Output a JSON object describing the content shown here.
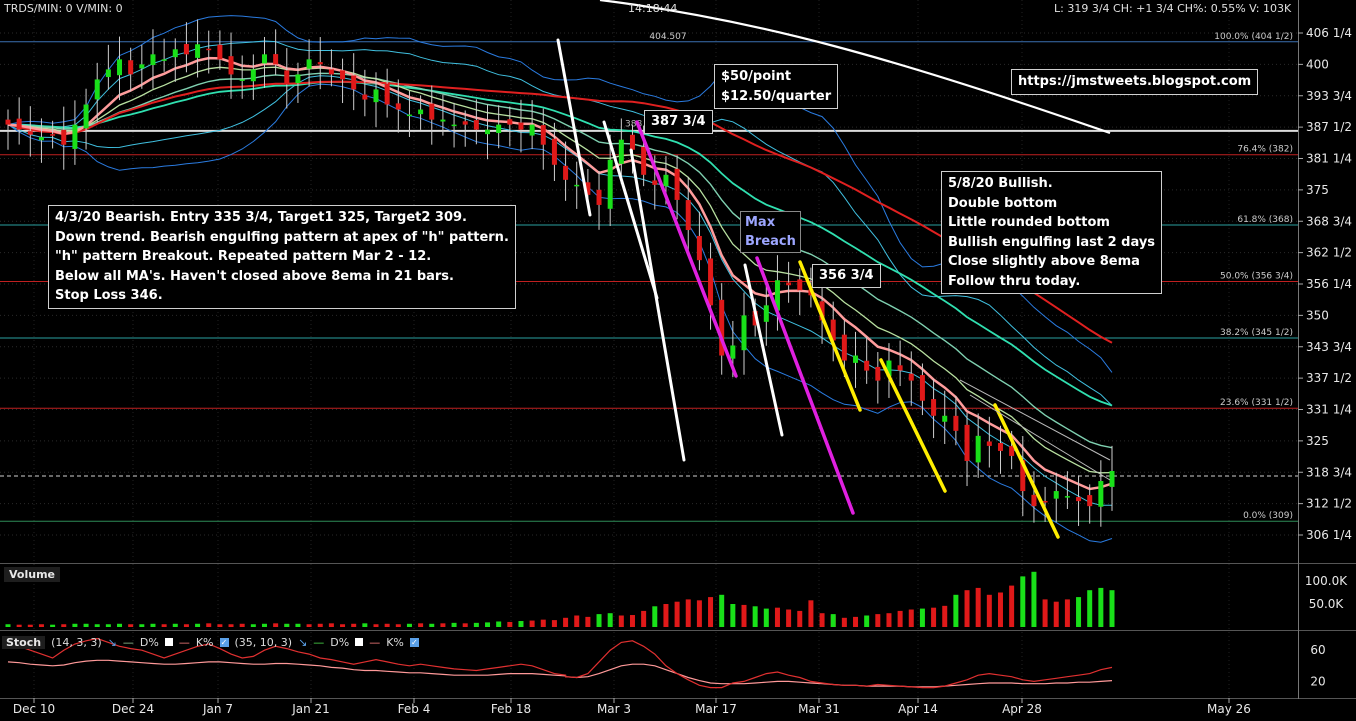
{
  "header": {
    "left": "TRDS/MIN: 0 V/MIN: 0",
    "time": "14:18:44",
    "right": "L: 319 3/4 CH: +1 3/4 CH%: 0.55% V: 103K"
  },
  "price_labels": [
    "406 1/4",
    "400",
    "393 3/4",
    "387 1/2",
    "381 1/4",
    "375",
    "368 3/4",
    "362 1/2",
    "356 1/4",
    "350",
    "343 3/4",
    "337 1/2",
    "331 1/4",
    "325",
    "318 3/4",
    "312 1/2",
    "306 1/4"
  ],
  "date_labels": [
    "Dec 10",
    "Dec 24",
    "Jan 7",
    "Jan 21",
    "Feb 4",
    "Feb 18",
    "Mar 3",
    "Mar 17",
    "Mar 31",
    "Apr 14",
    "Apr 28",
    "May 26"
  ],
  "fib_labels": [
    "100.0% (404 1/2)",
    "76.4% (382)",
    "61.8% (368)",
    "50.0% (356 3/4)",
    "38.2% (345 1/2)",
    "23.6% (331 1/2)",
    "0.0% (309)"
  ],
  "level_label": "404.507",
  "price_marker": "388",
  "volume": {
    "label": "Volume",
    "ticks": [
      "100.0K",
      "50.0K"
    ]
  },
  "stoch": {
    "label": "Stoch",
    "params1": "(14, 3, 3)",
    "params2": "(35, 10, 3)",
    "d_label": "D%",
    "k_label": "K%",
    "ticks": [
      "60",
      "20"
    ]
  },
  "annotations": {
    "point_value": "$50/point\n$12.50/quarter",
    "blog": "https://jmstweets.blogspot.com",
    "bearish": "4/3/20 Bearish. Entry 335 3/4, Target1 325, Target2 309.\nDown trend. Bearish engulfing pattern at apex of \"h\" pattern.\n\"h\" pattern Breakout. Repeated pattern Mar 2 - 12.\nBelow all MA's. Haven't closed above 8ema in 21 bars.\nStop Loss 346.",
    "price_387": "387 3/4",
    "max_breach": "Max\nBreach",
    "price_356": "356 3/4",
    "bullish": "5/8/20 Bullish.\nDouble bottom\nLittle rounded bottom\nBullish engulfing last 2 days\nClose slightly above 8ema\nFollow thru today."
  },
  "colors": {
    "up": "#19e019",
    "down": "#e01919",
    "ema8": "#ff9c9c",
    "ma_red": "#e02020",
    "ma_white": "#ffffff",
    "band": "#2a7be0",
    "band_light": "#40c0e0",
    "ma_teal": "#30e0b0",
    "fib_line": "#c02020",
    "magenta": "#e020e0",
    "yellow": "#ffee00",
    "white_line": "#ffffff"
  },
  "chart_data": {
    "type": "candlestick",
    "title": "",
    "y_axis": {
      "min": 303,
      "max": 409,
      "unit": "index points"
    },
    "fib_levels": [
      {
        "pct": "100.0%",
        "price": 404.5
      },
      {
        "pct": "76.4%",
        "price": 382
      },
      {
        "pct": "61.8%",
        "price": 368
      },
      {
        "pct": "50.0%",
        "price": 356.75
      },
      {
        "pct": "38.2%",
        "price": 345.5
      },
      {
        "pct": "23.6%",
        "price": 331.5
      },
      {
        "pct": "0.0%",
        "price": 309
      }
    ],
    "horizontal_levels": [
      404.5,
      386.75,
      318
    ],
    "closes": [
      388,
      387,
      386,
      385.5,
      386,
      384,
      388,
      392,
      397,
      399,
      401,
      398,
      400,
      402,
      401,
      403,
      402,
      404,
      403,
      401,
      398,
      397,
      399,
      402,
      400,
      396,
      398,
      401,
      400,
      398,
      397,
      395,
      393,
      395,
      392,
      391,
      390,
      391,
      389,
      389,
      388,
      388,
      387,
      387,
      388,
      388,
      387,
      388,
      384,
      380,
      377,
      376,
      374,
      372,
      381,
      385,
      383,
      378,
      376,
      378,
      373,
      367,
      361,
      352,
      342,
      344,
      350,
      348,
      352,
      357,
      356,
      355,
      354,
      349,
      345,
      341,
      342,
      339,
      337,
      341,
      339,
      337,
      333,
      330,
      330,
      327,
      321,
      326,
      324,
      323,
      322,
      315,
      312,
      313,
      315,
      314,
      313,
      312,
      317,
      319
    ],
    "volume_k": [
      6,
      5,
      5,
      6,
      5,
      6,
      7,
      7,
      6,
      6,
      7,
      6,
      6,
      7,
      6,
      7,
      6,
      7,
      8,
      6,
      6,
      7,
      6,
      7,
      8,
      6,
      7,
      7,
      6,
      7,
      8,
      6,
      7,
      8,
      6,
      7,
      6,
      7,
      8,
      7,
      8,
      9,
      8,
      9,
      10,
      12,
      11,
      13,
      14,
      16,
      15,
      20,
      25,
      22,
      28,
      30,
      25,
      26,
      35,
      45,
      50,
      55,
      60,
      58,
      65,
      70,
      50,
      48,
      45,
      40,
      42,
      38,
      35,
      58,
      30,
      25,
      28,
      20,
      22,
      25,
      28,
      30,
      35,
      38,
      40,
      42,
      46,
      70,
      80,
      85,
      70,
      75,
      90,
      110,
      120,
      60,
      55,
      60,
      65,
      80,
      85,
      80
    ],
    "stoch_fast_k": [
      70,
      65,
      60,
      55,
      50,
      60,
      68,
      72,
      75,
      70,
      65,
      62,
      60,
      55,
      50,
      55,
      60,
      65,
      68,
      62,
      55,
      50,
      52,
      60,
      65,
      62,
      58,
      55,
      50,
      48,
      45,
      42,
      45,
      48,
      45,
      42,
      40,
      42,
      40,
      38,
      36,
      35,
      34,
      36,
      38,
      40,
      42,
      40,
      35,
      30,
      28,
      26,
      25,
      30,
      45,
      60,
      70,
      72,
      65,
      55,
      40,
      30,
      22,
      15,
      12,
      12,
      18,
      20,
      25,
      30,
      32,
      28,
      25,
      20,
      18,
      16,
      15,
      15,
      14,
      16,
      15,
      14,
      13,
      12,
      12,
      14,
      18,
      22,
      28,
      30,
      28,
      26,
      22,
      20,
      22,
      24,
      26,
      28,
      30,
      35,
      38
    ],
    "stoch_slow_d": [
      45,
      44,
      42,
      41,
      40,
      41,
      44,
      46,
      47,
      47,
      46,
      45,
      44,
      43,
      42,
      42,
      43,
      44,
      45,
      45,
      44,
      43,
      42,
      42,
      43,
      43,
      42,
      41,
      40,
      38,
      37,
      35,
      34,
      34,
      33,
      32,
      31,
      31,
      30,
      29,
      28,
      28,
      28,
      28,
      29,
      30,
      30,
      30,
      29,
      28,
      27,
      26,
      25,
      26,
      30,
      35,
      40,
      42,
      42,
      40,
      35,
      30,
      25,
      21,
      18,
      17,
      17,
      17,
      18,
      19,
      20,
      20,
      19,
      18,
      17,
      16,
      15,
      15,
      14,
      14,
      14,
      14,
      13,
      13,
      13,
      14,
      15,
      16,
      17,
      18,
      18,
      18,
      17,
      17,
      17,
      18,
      18,
      19,
      19,
      20,
      21
    ]
  }
}
